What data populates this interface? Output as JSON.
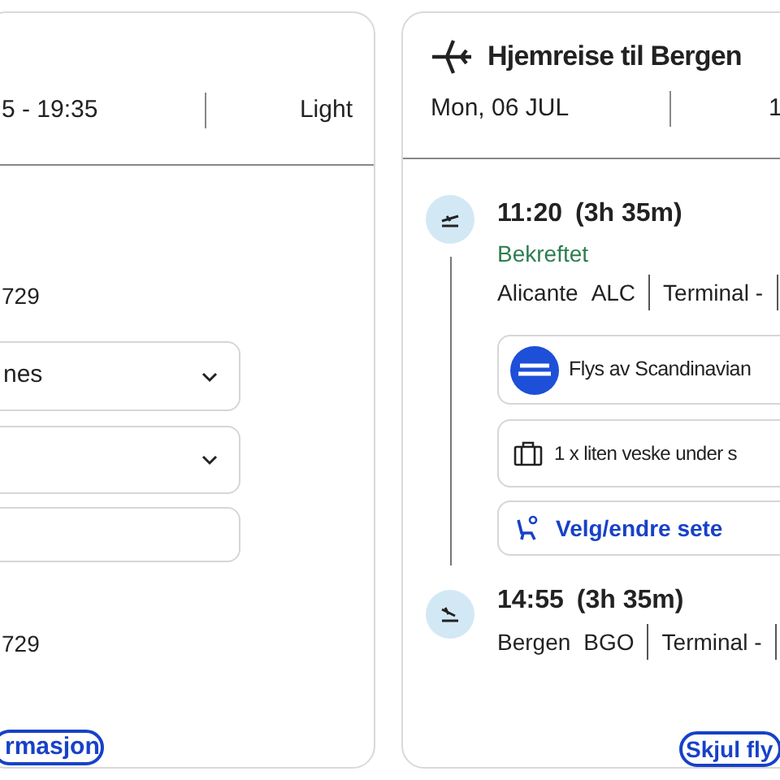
{
  "outbound_card": {
    "time_range": "5 - 19:35",
    "fare": "Light",
    "flight_number_1": "729",
    "select_value": "nes",
    "flight_number_2": "729",
    "link": "rmasjon"
  },
  "return_card": {
    "title": "Hjemreise til Bergen",
    "date": "Mon, 06 JUL",
    "column_2": "1",
    "departure": {
      "time": "11:20",
      "duration": "(3h 35m)",
      "status": "Bekreftet",
      "airport": "Alicante",
      "code": "ALC",
      "terminal": "Terminal -"
    },
    "operator": "Flys av Scandinavian",
    "baggage": "1 x liten veske under s",
    "seat_link": "Velg/endre sete",
    "arrival": {
      "time": "14:55",
      "duration": "(3h 35m)",
      "airport": "Bergen",
      "code": "BGO",
      "terminal": "Terminal -"
    },
    "link": "Skjul fly"
  }
}
